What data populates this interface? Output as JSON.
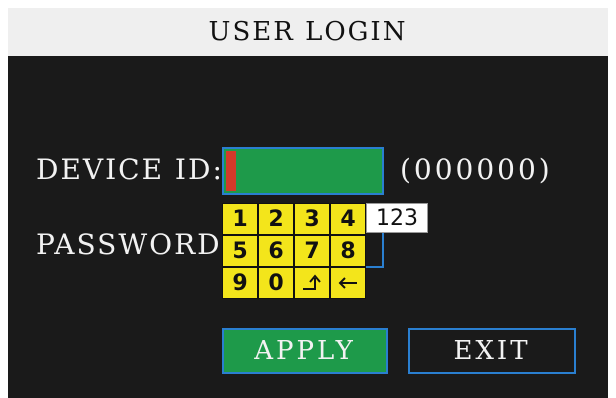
{
  "title": "USER LOGIN",
  "device_id": {
    "label": "DEVICE ID:",
    "hint": "(000000)"
  },
  "password": {
    "label": "PASSWORD:"
  },
  "keypad": {
    "keys": [
      "1",
      "2",
      "3",
      "4",
      "5",
      "6",
      "7",
      "8",
      "9",
      "0",
      "↰",
      "←"
    ],
    "mode": "123"
  },
  "buttons": {
    "apply": "APPLY",
    "exit": "EXIT"
  },
  "colors": {
    "titlebar": "#efefef",
    "background": "#1a1a1a",
    "field_active": "#1e9a4a",
    "border": "#2a7fd0",
    "cursor": "#d33a2a",
    "key": "#f3e51b"
  },
  "icons": {
    "enter_key": "enter-icon",
    "backspace_key": "backspace-arrow-icon"
  }
}
